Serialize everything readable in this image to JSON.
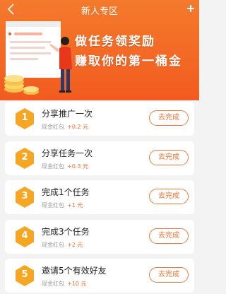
{
  "header": {
    "title": "新人专区",
    "slogan_line1": "做任务领奖励",
    "slogan_line2": "赚取你的第一桶金"
  },
  "colors": {
    "accent": "#f2652a",
    "hex_badge": "#f5a623",
    "button_border": "#f07a3a"
  },
  "tasks": [
    {
      "num": "1",
      "title": "分享推广一次",
      "reward_label": "现金红包",
      "reward_value": "+0.2 元",
      "button": "去完成"
    },
    {
      "num": "2",
      "title": "分享任务一次",
      "reward_label": "现金红包",
      "reward_value": "+0.3 元",
      "button": "去完成"
    },
    {
      "num": "3",
      "title": "完成1个任务",
      "reward_label": "现金红包",
      "reward_value": "+1 元",
      "button": "去完成"
    },
    {
      "num": "4",
      "title": "完成3个任务",
      "reward_label": "现金红包",
      "reward_value": "+2 元",
      "button": "去完成"
    },
    {
      "num": "5",
      "title": "邀请5个有效好友",
      "reward_label": "现金红包",
      "reward_value": "+10 元",
      "button": "去完成"
    }
  ]
}
